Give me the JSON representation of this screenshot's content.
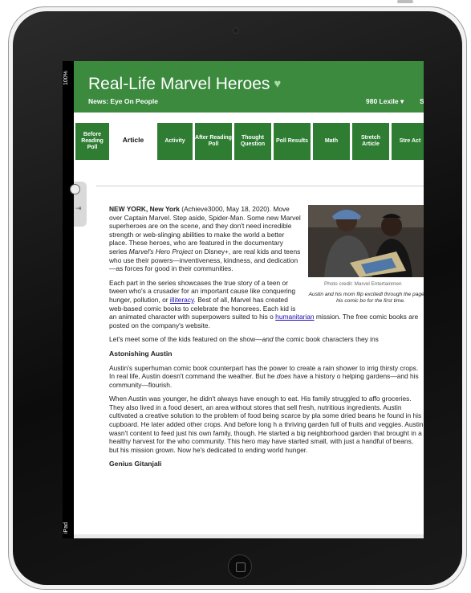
{
  "status_bar": {
    "battery": "100%",
    "device": "iPad"
  },
  "header": {
    "title": "Real-Life Marvel Heroes",
    "subtitle": "News: Eye On People",
    "lexile": "980 Lexile ▾",
    "lexile_extra": "S"
  },
  "tabs": [
    {
      "label": "Before Reading Poll"
    },
    {
      "label": "Article"
    },
    {
      "label": "Activity"
    },
    {
      "label": "After Reading Poll"
    },
    {
      "label": "Thought Question"
    },
    {
      "label": "Poll Results"
    },
    {
      "label": "Math"
    },
    {
      "label": "Stretch Article"
    },
    {
      "label": "Stre Act"
    }
  ],
  "article": {
    "p1_dateline": "NEW YORK, New York",
    "p1_text": " (Achieve3000, May 18, 2020). Move over Captain Marvel. Step aside, Spider-Man. Some new Marvel superheroes are on the scene, and they don't need incredible strength or web-slinging abilities to make the world a better place. These heroes, who are featured in the documentary series ",
    "p1_series": "Marvel's Hero Project",
    "p1_text2": " on Disney+, are real kids and teens who use their powers—inventiveness, kindness, and dedication—as forces for good in their communities.",
    "p2_a": "Each part in the series showcases the true story of a teen or tween who's a crusader for an important cause like conquering hunger, pollution, or ",
    "p2_link1": "illiteracy",
    "p2_b": ". Best of all, Marvel has created web-based comic books to celebrate the honorees. Each kid is an animated character with superpowers suited to his o",
    "p2_link2": "humanitarian",
    "p2_c": " mission. The free comic books are posted on the company's website.",
    "p3_a": "Let's meet some of the kids featured on the show—",
    "p3_em": "and",
    "p3_b": " the comic book characters they ins",
    "h1": "Astonishing Austin",
    "p4_a": "Austin's superhuman comic book counterpart has the power to create a rain shower to irrig thirsty crops. In real life, Austin doesn't command the weather. But he ",
    "p4_em": "does",
    "p4_b": " have a history o helping gardens—and his community—flourish.",
    "p5": "When Austin was younger, he didn't always have enough to eat. His family struggled to affo groceries. They also lived in a food desert, an area without stores that sell fresh, nutritious ingredients. Austin cultivated a creative solution to the problem of food being scarce by pla some dried beans he found in his cupboard. He later added other crops. And before long h a thriving garden full of fruits and veggies. Austin wasn't content to feed just his own family, though. He started a big neighborhood garden that brought in a healthy harvest for the who community. This hero may have started small, with just a handful of beans, but his mission grown. Now he's dedicated to ending world hunger.",
    "h2": "Genius Gitanjali",
    "photo_credit": "Photo credit: Marvel Entertainmen",
    "photo_caption": "Austin and his mom flip excitedl through the pages of his comic bo for the first time."
  },
  "colors": {
    "header_green": "#3b8a3e",
    "tab_green": "#2e7d32",
    "link": "#1a0dab"
  }
}
